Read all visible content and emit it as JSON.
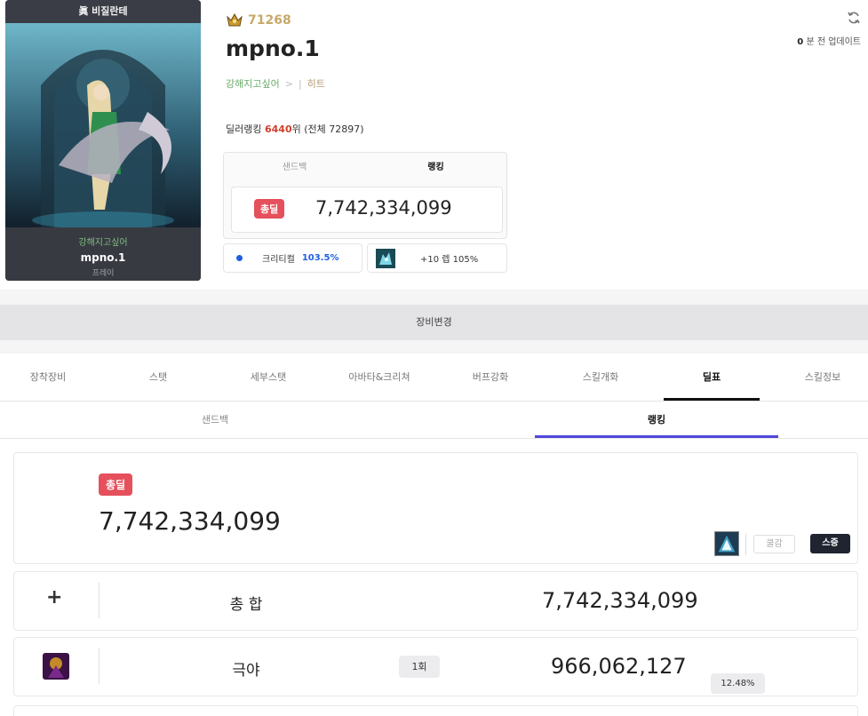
{
  "avatar": {
    "banner": "眞 비질란테",
    "guild": "강해지고싶어",
    "name": "mpno.1",
    "server": "프레이"
  },
  "profile": {
    "fame": "71268",
    "name": "mpno.1",
    "guild": "강해지고싶어",
    "chevron": ">",
    "separator": "|",
    "adventure": "히트",
    "rank_label": "딜러랭킹",
    "rank_value": "6440",
    "rank_suffix": "위",
    "rank_total": "(전체 72897)"
  },
  "update": {
    "minutes": "0",
    "text": "분 전 업데이트"
  },
  "damage_box": {
    "tabs": [
      "샌드백",
      "랭킹"
    ],
    "active_tab": 1,
    "badge": "총딜",
    "value": "7,742,334,099"
  },
  "crit_card": {
    "label": "크리티컬",
    "value": "103.5%"
  },
  "skill_card": {
    "label": "+10 렙 105%"
  },
  "equip_bar": {
    "label": "장비변경"
  },
  "tabs": [
    "장착장비",
    "스탯",
    "세부스탯",
    "아바타&크리쳐",
    "버프강화",
    "스킬개화",
    "딜표",
    "스킬정보"
  ],
  "active_tab": 6,
  "subtabs": [
    "샌드백",
    "랭킹"
  ],
  "active_subtab": 1,
  "total": {
    "badge": "총딜",
    "value": "7,742,334,099",
    "cooldown_button": "쿨감",
    "stack_button": "스증"
  },
  "rows": [
    {
      "icon": "+",
      "name": "총 합",
      "value": "7,742,334,099"
    },
    {
      "name": "극야",
      "count": "1회",
      "value": "966,062,127",
      "percent": "12.48%"
    }
  ],
  "colors": {
    "accent_red": "#e5505c",
    "rank_red": "#d0402d",
    "crit_blue": "#1e5fe0",
    "subtab_purple": "#5148d9",
    "fame_gold": "#c8a96a"
  }
}
